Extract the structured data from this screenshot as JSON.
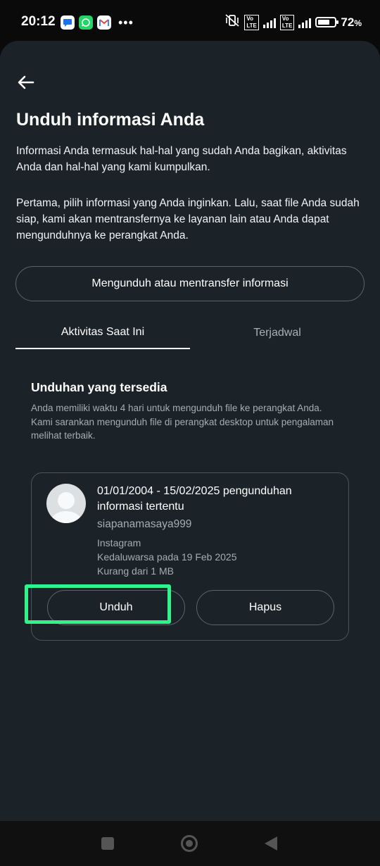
{
  "status_bar": {
    "time": "20:12",
    "app_icons": [
      "messages-icon",
      "whatsapp-icon",
      "gmail-icon"
    ],
    "battery_percent": "72",
    "battery_unit": "%",
    "battery_level": 0.72
  },
  "header": {
    "title": "Unduh informasi Anda"
  },
  "intro": {
    "paragraph1": "Informasi Anda termasuk hal-hal yang sudah Anda bagikan, aktivitas Anda dan hal-hal yang kami kumpulkan.",
    "paragraph2": "Pertama, pilih informasi yang Anda inginkan. Lalu, saat file Anda sudah siap, kami akan mentransfernya ke layanan lain atau Anda dapat mengunduhnya ke perangkat Anda."
  },
  "transfer_button_label": "Mengunduh atau mentransfer informasi",
  "tabs": {
    "active": "Aktivitas Saat Ini",
    "inactive": "Terjadwal"
  },
  "available": {
    "title": "Unduhan yang tersedia",
    "desc_line1": "Anda memiliki waktu 4 hari untuk mengunduh file ke perangkat Anda.",
    "desc_line2": "Kami sarankan mengunduh file di perangkat desktop untuk pengalaman melihat terbaik."
  },
  "download_item": {
    "title": "01/01/2004 - 15/02/2025 pengunduhan informasi tertentu",
    "username": "siapanamasaya999",
    "platform": "Instagram",
    "expiry": "Kedaluwarsa pada 19 Feb 2025",
    "size": "Kurang dari 1 MB",
    "download_label": "Unduh",
    "delete_label": "Hapus"
  },
  "colors": {
    "background": "#1b2329",
    "highlight": "#2ef48c",
    "muted_text": "#a4adb4"
  }
}
